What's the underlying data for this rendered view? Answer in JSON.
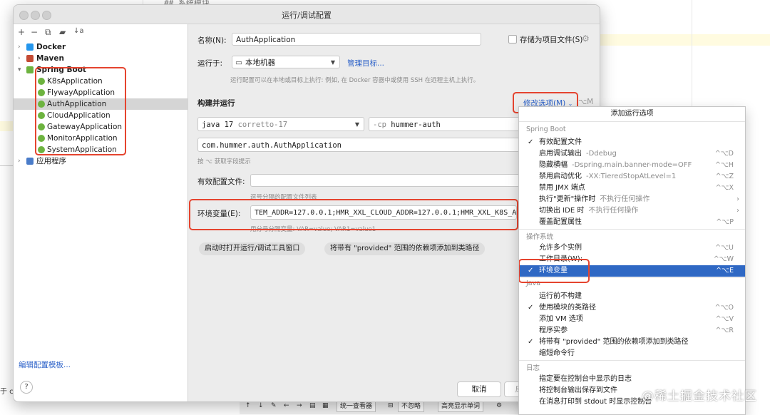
{
  "background": {
    "code_text": "## 系统模块",
    "left_edge_text": "于 cl",
    "bottom_bar": [
      "统一查看器",
      "不忽略",
      "高亮显示单词"
    ]
  },
  "dialog": {
    "title": "运行/调试配置",
    "toolbar": {
      "add": "+",
      "remove": "−",
      "copy": "⧉",
      "folder": "▰",
      "sort": "↓a"
    },
    "tree": [
      {
        "label": "Docker",
        "bold": true,
        "expanded": false,
        "icon": "docker-icon",
        "color": "#2496ed"
      },
      {
        "label": "Maven",
        "bold": true,
        "expanded": false,
        "icon": "maven-icon",
        "color": "#c44b34"
      },
      {
        "label": "Spring Boot",
        "bold": true,
        "expanded": true,
        "icon": "spring-boot-icon",
        "color": "#6db33f"
      },
      {
        "label": "K8sApplication",
        "child": true
      },
      {
        "label": "FlywayApplication",
        "child": true
      },
      {
        "label": "AuthApplication",
        "child": true,
        "selected": true
      },
      {
        "label": "CloudApplication",
        "child": true
      },
      {
        "label": "GatewayApplication",
        "child": true
      },
      {
        "label": "MonitorApplication",
        "child": true
      },
      {
        "label": "SystemApplication",
        "child": true
      },
      {
        "label": "应用程序",
        "bold": false,
        "expanded": false,
        "icon": "application-icon",
        "color": "#4a7cc9"
      }
    ],
    "edit_templates": "编辑配置模板...",
    "help": "?",
    "form": {
      "name_label": "名称(N):",
      "name_value": "AuthApplication",
      "store_as_file": "存储为项目文件(S)",
      "run_on_label": "运行于:",
      "run_on_value": "本地机器",
      "manage_targets": "管理目标...",
      "run_on_hint": "运行配置可以在本地或目标上执行: 例如, 在 Docker 容器中或使用 SSH 在远程主机上执行。",
      "build_run": "构建并运行",
      "modify_options": "修改选项(M)",
      "modify_shortcut": "⌥M",
      "jdk_value": "java 17",
      "jdk_sub": "corretto-17",
      "cp_prefix": "-cp",
      "cp_value": "hummer-auth",
      "main_class": "com.hummer.auth.AuthApplication",
      "main_hint": "按 ⌥ 获取字段提示",
      "active_profiles_label": "有效配置文件:",
      "active_profiles_value": "",
      "active_profiles_hint": "逗号分隔的配置文件列表",
      "env_label": "环境变量(E):",
      "env_value": "TEM_ADDR=127.0.0.1;HMR_XXL_CLOUD_ADDR=127.0.0.1;HMR_XXL_K8S_A",
      "env_hint": "用分号分隔变量: VAR=value; VAR1=value1",
      "chip1": "启动时打开运行/调试工具窗口",
      "chip2": "将带有 \"provided\" 范围的依赖项添加到类路径"
    },
    "footer": {
      "cancel": "取消",
      "apply": "应"
    }
  },
  "popup": {
    "title": "添加运行选项",
    "sections": [
      {
        "title": "Spring Boot",
        "items": [
          {
            "label": "有效配置文件",
            "checked": true,
            "sub": "",
            "shortcut": "",
            "submenu": false
          },
          {
            "label": "启用调试输出",
            "checked": false,
            "sub": "-Ddebug",
            "shortcut": "^⌥D",
            "submenu": false
          },
          {
            "label": "隐藏横幅",
            "checked": false,
            "sub": "-Dspring.main.banner-mode=OFF",
            "shortcut": "^⌥H",
            "submenu": false
          },
          {
            "label": "禁用启动优化",
            "checked": false,
            "sub": "-XX:TieredStopAtLevel=1",
            "shortcut": "^⌥Z",
            "submenu": false
          },
          {
            "label": "禁用 JMX 端点",
            "checked": false,
            "sub": "",
            "shortcut": "^⌥X",
            "submenu": false
          },
          {
            "label": "执行\"更新\"操作时",
            "checked": false,
            "sub": "不执行任何操作",
            "shortcut": "",
            "submenu": true
          },
          {
            "label": "切换出 IDE 时",
            "checked": false,
            "sub": "不执行任何操作",
            "shortcut": "",
            "submenu": true
          },
          {
            "label": "覆盖配置属性",
            "checked": false,
            "sub": "",
            "shortcut": "^⌥P",
            "submenu": false
          }
        ]
      },
      {
        "title": "操作系统",
        "items": [
          {
            "label": "允许多个实例",
            "checked": false,
            "sub": "",
            "shortcut": "^⌥U",
            "submenu": false
          },
          {
            "label": "工作目录(W):",
            "checked": false,
            "sub": "",
            "shortcut": "^⌥W",
            "submenu": false
          },
          {
            "label": "环境变量",
            "checked": true,
            "sub": "",
            "shortcut": "^⌥E",
            "submenu": false,
            "active": true
          }
        ]
      },
      {
        "title": "Java",
        "items": [
          {
            "label": "运行前不构建",
            "checked": false,
            "sub": "",
            "shortcut": "",
            "submenu": false
          },
          {
            "label": "使用模块的类路径",
            "checked": true,
            "sub": "",
            "shortcut": "^⌥O",
            "submenu": false
          },
          {
            "label": "添加 VM 选项",
            "checked": false,
            "sub": "",
            "shortcut": "^⌥V",
            "submenu": false
          },
          {
            "label": "程序实参",
            "checked": false,
            "sub": "",
            "shortcut": "^⌥R",
            "submenu": false
          },
          {
            "label": "将带有 \"provided\" 范围的依赖项添加到类路径",
            "checked": true,
            "sub": "",
            "shortcut": "",
            "submenu": false
          },
          {
            "label": "缩短命令行",
            "checked": false,
            "sub": "",
            "shortcut": "",
            "submenu": false
          }
        ]
      },
      {
        "title": "日志",
        "items": [
          {
            "label": "指定要在控制台中显示的日志",
            "checked": false,
            "sub": "",
            "shortcut": "",
            "submenu": false
          },
          {
            "label": "将控制台输出保存到文件",
            "checked": false,
            "sub": "",
            "shortcut": "",
            "submenu": false
          },
          {
            "label": "在消息打印到 stdout 时显示控制台",
            "checked": false,
            "sub": "",
            "shortcut": "",
            "submenu": false
          }
        ]
      }
    ]
  },
  "watermark": "@稀土掘金技术社区",
  "colors": {
    "accent": "#2f68c4",
    "highlight_red": "#e5442f",
    "link": "#2e63c9"
  }
}
